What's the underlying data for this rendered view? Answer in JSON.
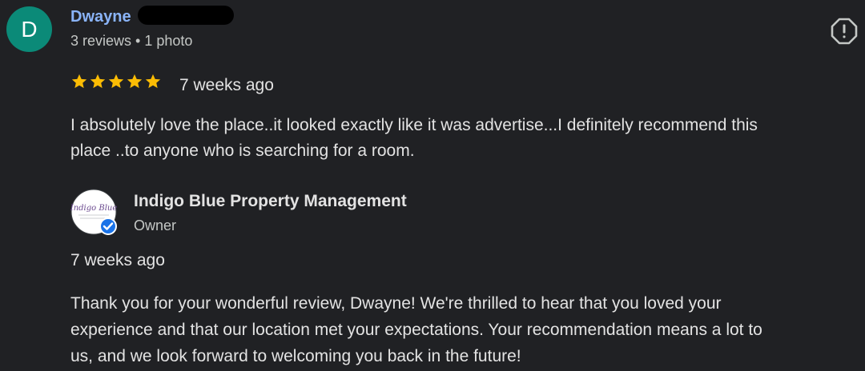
{
  "reviewer": {
    "initial": "D",
    "name": "Dwayne",
    "meta": "3 reviews • 1 photo"
  },
  "review": {
    "rating": 5,
    "date": "7 weeks ago",
    "text_lines": [
      "I absolutely love the place..it looked exactly like it was advertise...I definitely recommend this",
      "place ..to anyone who is searching for a room."
    ]
  },
  "owner_reply": {
    "name": "Indigo Blue Property Management",
    "role": "Owner",
    "logo_text": "Indigo Blue",
    "date": "7 weeks ago",
    "text_lines": [
      "Thank you for your wonderful review, Dwayne! We're thrilled to hear that you loved your",
      "experience and that our location met your expectations. Your recommendation means a lot to",
      "us, and we look forward to welcoming you back in the future!"
    ]
  },
  "icons": {
    "report": "report-flag-icon",
    "star": "star-icon",
    "verified": "verified-badge-icon"
  },
  "colors": {
    "background": "#202124",
    "avatar": "#0b8a78",
    "name": "#8ab4f8",
    "star": "#fbbc04",
    "verified": "#1a73e8"
  }
}
